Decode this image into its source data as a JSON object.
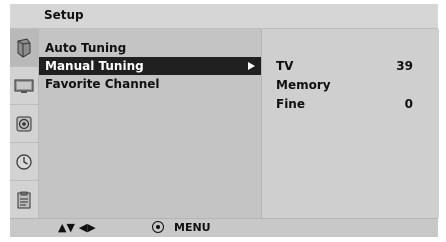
{
  "title": "Setup",
  "sidebar_icons": [
    "setup-icon",
    "picture-icon",
    "sound-icon",
    "time-icon",
    "option-icon"
  ],
  "menu": {
    "items": [
      {
        "label": "Auto Tuning"
      },
      {
        "label": "Manual Tuning",
        "selected": true
      },
      {
        "label": "Favorite Channel"
      }
    ]
  },
  "submenu": {
    "rows": [
      {
        "label": "TV",
        "value": "39"
      },
      {
        "label": "Memory",
        "value": ""
      },
      {
        "label": "Fine",
        "value": "0"
      }
    ]
  },
  "footer": {
    "nav_hint": "▲▼ ◀▶",
    "ok_icon": "ok-icon",
    "menu_label": "MENU"
  },
  "colors": {
    "highlight": "#202020",
    "panel": "#c4c4c4",
    "right_panel": "#cfcfcf"
  }
}
